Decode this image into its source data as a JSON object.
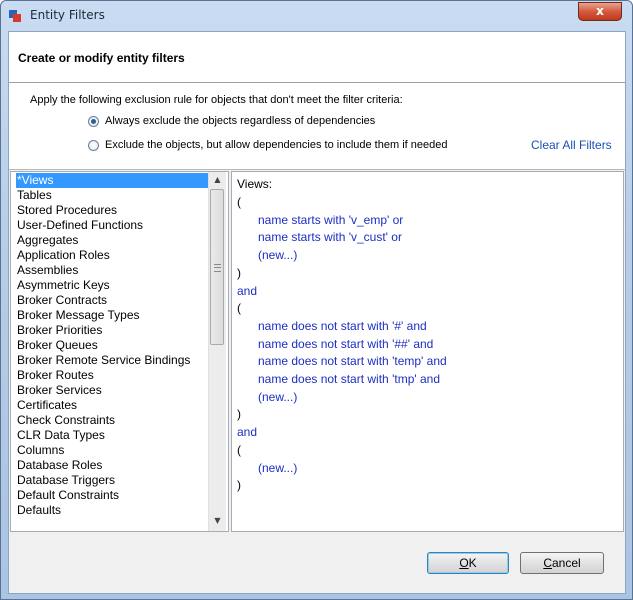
{
  "window": {
    "title": "Entity Filters",
    "close_glyph": "x"
  },
  "header": {
    "title": "Create or modify entity filters"
  },
  "rule": {
    "prompt": "Apply the following exclusion rule for objects that don't meet the filter criteria:",
    "options": [
      {
        "label": "Always exclude the objects regardless of dependencies",
        "selected": true
      },
      {
        "label": "Exclude the objects, but allow dependencies to include them if needed",
        "selected": false
      }
    ],
    "clear_all": "Clear All Filters"
  },
  "object_types": [
    "*Views",
    "Tables",
    "Stored Procedures",
    "User-Defined Functions",
    "Aggregates",
    "Application Roles",
    "Assemblies",
    "Asymmetric Keys",
    "Broker Contracts",
    "Broker Message Types",
    "Broker Priorities",
    "Broker Queues",
    "Broker Remote Service Bindings",
    "Broker Routes",
    "Broker Services",
    "Certificates",
    "Check Constraints",
    "CLR Data Types",
    "Columns",
    "Database Roles",
    "Database Triggers",
    "Default Constraints",
    "Defaults"
  ],
  "selected_object_type": "*Views",
  "filter": {
    "heading": "Views:",
    "lines": [
      {
        "text": "(",
        "indent": 0,
        "color": "black"
      },
      {
        "text": "name starts with 'v_emp' or",
        "indent": 1,
        "color": "blue"
      },
      {
        "text": "name starts with 'v_cust' or",
        "indent": 1,
        "color": "blue"
      },
      {
        "text": "(new...)",
        "indent": 1,
        "color": "blue"
      },
      {
        "text": ")",
        "indent": 0,
        "color": "black"
      },
      {
        "text": "and",
        "indent": 0,
        "color": "blue"
      },
      {
        "text": "(",
        "indent": 0,
        "color": "black"
      },
      {
        "text": "name does not start with '#' and",
        "indent": 1,
        "color": "blue"
      },
      {
        "text": "name does not start with '##' and",
        "indent": 1,
        "color": "blue"
      },
      {
        "text": "name does not start with 'temp' and",
        "indent": 1,
        "color": "blue"
      },
      {
        "text": "name does not start with 'tmp' and",
        "indent": 1,
        "color": "blue"
      },
      {
        "text": "(new...)",
        "indent": 1,
        "color": "blue"
      },
      {
        "text": ")",
        "indent": 0,
        "color": "black"
      },
      {
        "text": "and",
        "indent": 0,
        "color": "blue"
      },
      {
        "text": "(",
        "indent": 0,
        "color": "black"
      },
      {
        "text": "(new...)",
        "indent": 1,
        "color": "blue"
      },
      {
        "text": ")",
        "indent": 0,
        "color": "black"
      }
    ]
  },
  "buttons": {
    "ok": {
      "mnemonic": "O",
      "rest": "K"
    },
    "cancel": {
      "mnemonic": "C",
      "rest": "ancel"
    }
  },
  "colors": {
    "link": "#1a4fb5",
    "filter_text": "#1c2ec3",
    "selection": "#3399ff"
  }
}
